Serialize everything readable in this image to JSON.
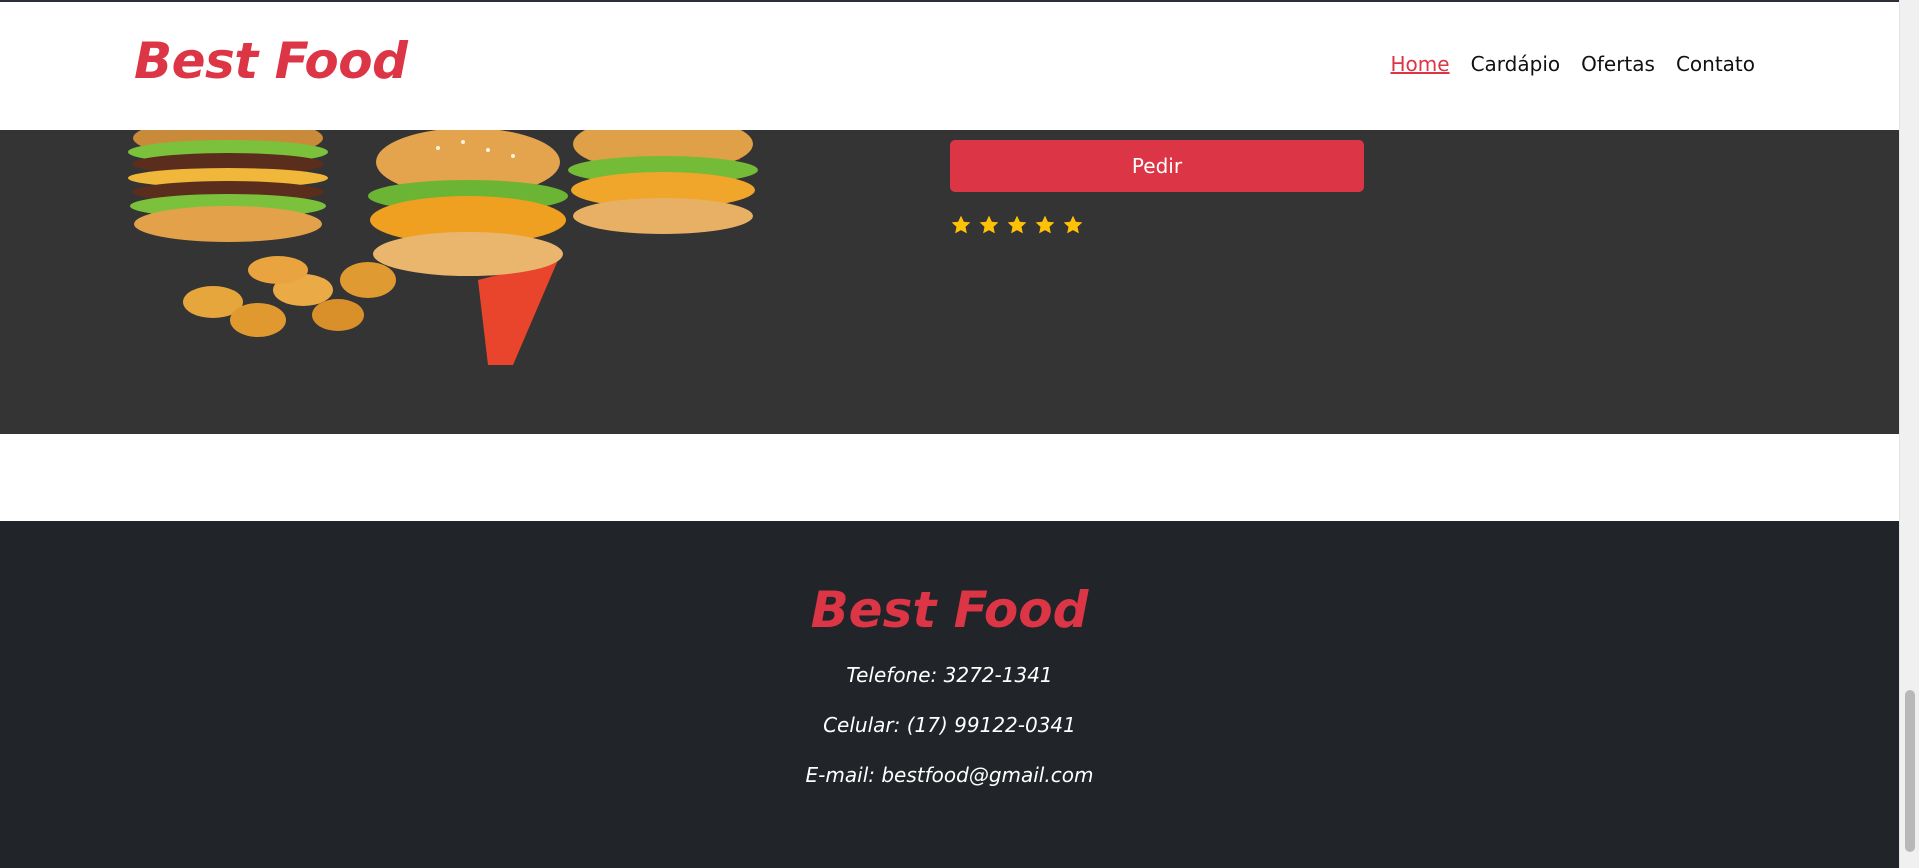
{
  "header": {
    "brand": "Best Food",
    "nav": [
      {
        "label": "Home",
        "active": true
      },
      {
        "label": "Cardápio",
        "active": false
      },
      {
        "label": "Ofertas",
        "active": false
      },
      {
        "label": "Contato",
        "active": false
      }
    ]
  },
  "hero": {
    "image_icon": "burgers-and-nuggets-illustration",
    "order_button": "Pedir",
    "rating": {
      "value": 5,
      "max": 5,
      "icon": "star-icon",
      "color": "#ffc107"
    }
  },
  "footer": {
    "brand": "Best Food",
    "phone": "Telefone: 3272-1341",
    "mobile": "Celular: (17) 99122-0341",
    "email": "E-mail: bestfood@gmail.com"
  },
  "colors": {
    "accent": "#dc3545",
    "hero_bg": "#343434",
    "footer_bg": "#212529",
    "star": "#ffc107"
  }
}
